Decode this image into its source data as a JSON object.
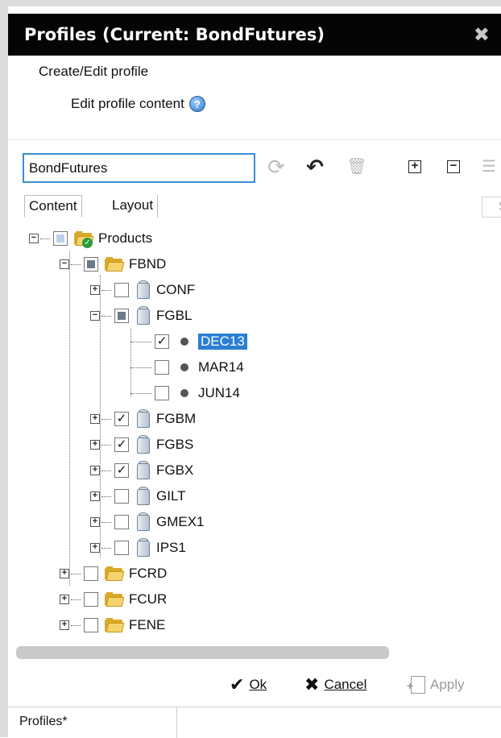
{
  "window": {
    "title": "Profiles (Current: BondFutures)"
  },
  "header": {
    "create_edit": "Create/Edit profile",
    "edit_content": "Edit profile content"
  },
  "toolbar": {
    "profile_name": "BondFutures"
  },
  "tabs": [
    {
      "label": "Content"
    },
    {
      "label": "Layout"
    }
  ],
  "search": {
    "placeholder": "S"
  },
  "tree": {
    "root": "Products",
    "fbnd": "FBND",
    "conf": "CONF",
    "fgbl": "FGBL",
    "dec13": "DEC13",
    "mar14": "MAR14",
    "jun14": "JUN14",
    "fgbm": "FGBM",
    "fgbs": "FGBS",
    "fgbx": "FGBX",
    "gilt": "GILT",
    "gmex1": "GMEX1",
    "ips1": "IPS1",
    "fcrd": "FCRD",
    "fcur": "FCUR",
    "fene": "FENE"
  },
  "footer": {
    "ok_label": "Ok",
    "cancel_label": "Cancel",
    "apply_label": "Apply"
  },
  "status": {
    "text": "Profiles*"
  },
  "colors": {
    "titlebar": "#050505",
    "selection": "#2a7fd4",
    "folder": "#f5d46e",
    "focus_border": "#3b8ed8"
  }
}
